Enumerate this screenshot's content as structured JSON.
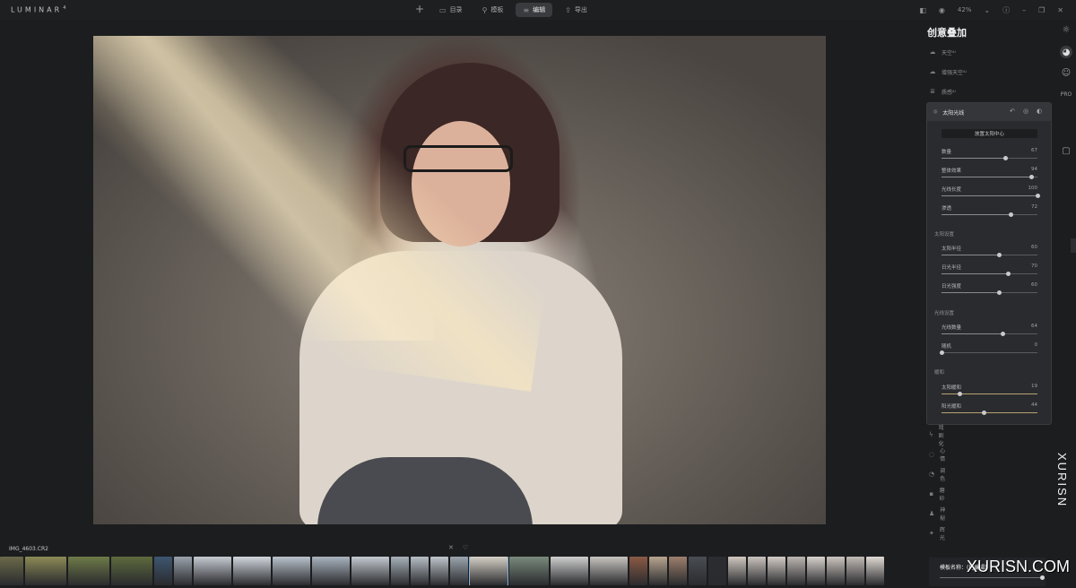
{
  "app": {
    "logo": "LUMINAR",
    "version_mark": "4",
    "zoom": "42%"
  },
  "toolbar": {
    "add_icon": "plus-icon",
    "tabs": [
      {
        "label": "目录",
        "icon": "folder-icon",
        "active": false
      },
      {
        "label": "模板",
        "icon": "templates-icon",
        "active": false
      },
      {
        "label": "编辑",
        "icon": "sliders-icon",
        "active": true
      },
      {
        "label": "导出",
        "icon": "share-icon",
        "active": false
      }
    ]
  },
  "panel": {
    "title": "创意叠加",
    "tools_top": [
      {
        "label": "天空ᴬᴵ",
        "icon": "cloud-icon"
      },
      {
        "label": "增强天空ᴬᴵ",
        "icon": "cloud-icon"
      },
      {
        "label": "质感ᴬᴵ",
        "icon": "texture-icon"
      }
    ],
    "sunrays": {
      "title": "太阳光线",
      "place_button": "放置太阳中心",
      "sliders_main": [
        {
          "label": "数量",
          "value": 67
        },
        {
          "label": "整体效果",
          "value": 94
        },
        {
          "label": "光线长度",
          "value": 100
        },
        {
          "label": "渗透",
          "value": 72
        }
      ],
      "section_sun": "太阳设置",
      "sliders_sun": [
        {
          "label": "太阳半径",
          "value": 60
        },
        {
          "label": "日光半径",
          "value": 70
        },
        {
          "label": "日光强度",
          "value": 60
        }
      ],
      "section_rays": "光线设置",
      "sliders_rays": [
        {
          "label": "光线数量",
          "value": 64
        },
        {
          "label": "随机",
          "value": 0
        }
      ],
      "section_warmth": "暖和",
      "sliders_warmth": [
        {
          "label": "太阳暖和",
          "value": 19
        },
        {
          "label": "阳光暖和",
          "value": 44
        }
      ]
    },
    "tools_bottom": [
      {
        "label": "戏剧化",
        "icon": "lightning-icon"
      },
      {
        "label": "心情",
        "icon": "mood-icon"
      },
      {
        "label": "调色",
        "icon": "palette-icon"
      },
      {
        "label": "磨砂",
        "icon": "matte-icon"
      },
      {
        "label": "神秘",
        "icon": "mystical-icon"
      },
      {
        "label": "辉光",
        "icon": "sparkle-icon"
      }
    ]
  },
  "filmstrip": {
    "filename": "IMG_4603.CR2"
  },
  "bottom_panel": {
    "label": "模板名称：(已编辑)"
  },
  "watermark": {
    "vertical": "XURISN",
    "horizontal": "XURISN.COM"
  },
  "colors": {
    "accent_blue": "#7fb0d8",
    "warmth_track": "#b8a374",
    "panel_bg": "#2a2b2e"
  }
}
